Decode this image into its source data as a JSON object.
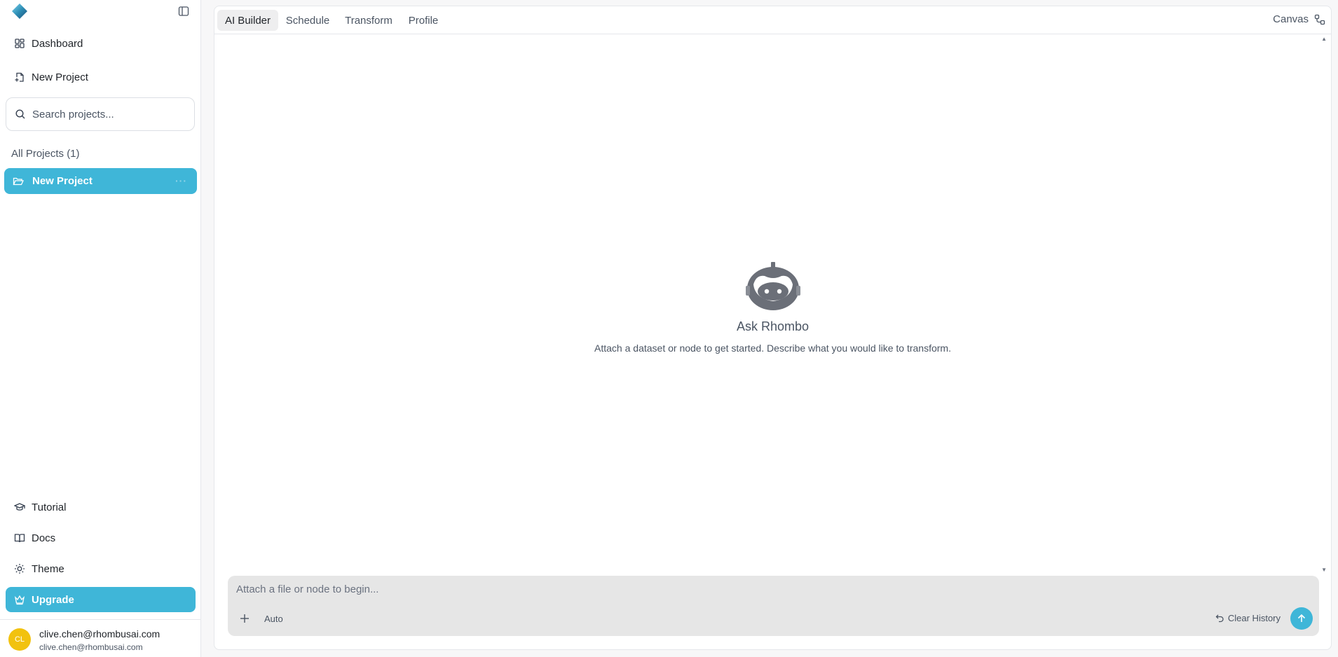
{
  "app": {
    "accent_color": "#3fb6d8"
  },
  "sidebar": {
    "nav": [
      {
        "label": "Dashboard",
        "icon": "dashboard-icon"
      },
      {
        "label": "New Project",
        "icon": "new-file-icon"
      }
    ],
    "search_placeholder": "Search projects...",
    "section_label": "All Projects (1)",
    "projects": [
      {
        "label": "New Project",
        "icon": "folder-open-icon",
        "selected": true
      }
    ],
    "footer_nav": [
      {
        "label": "Tutorial",
        "icon": "graduation-cap-icon"
      },
      {
        "label": "Docs",
        "icon": "book-icon"
      },
      {
        "label": "Theme",
        "icon": "sun-icon"
      }
    ],
    "upgrade_label": "Upgrade",
    "user": {
      "initials": "CL",
      "name": "clive.chen@rhombusai.com",
      "email": "clive.chen@rhombusai.com",
      "avatar_color": "#f2c20f"
    }
  },
  "tabs": [
    {
      "label": "AI Builder",
      "active": true
    },
    {
      "label": "Schedule",
      "active": false
    },
    {
      "label": "Transform",
      "active": false
    },
    {
      "label": "Profile",
      "active": false
    }
  ],
  "canvas_label": "Canvas",
  "empty_state": {
    "title": "Ask Rhombo",
    "subtitle": "Attach a dataset or node to get started. Describe what you would like to transform."
  },
  "composer": {
    "placeholder": "Attach a file or node to begin...",
    "mode": "Auto",
    "clear_history": "Clear History"
  }
}
